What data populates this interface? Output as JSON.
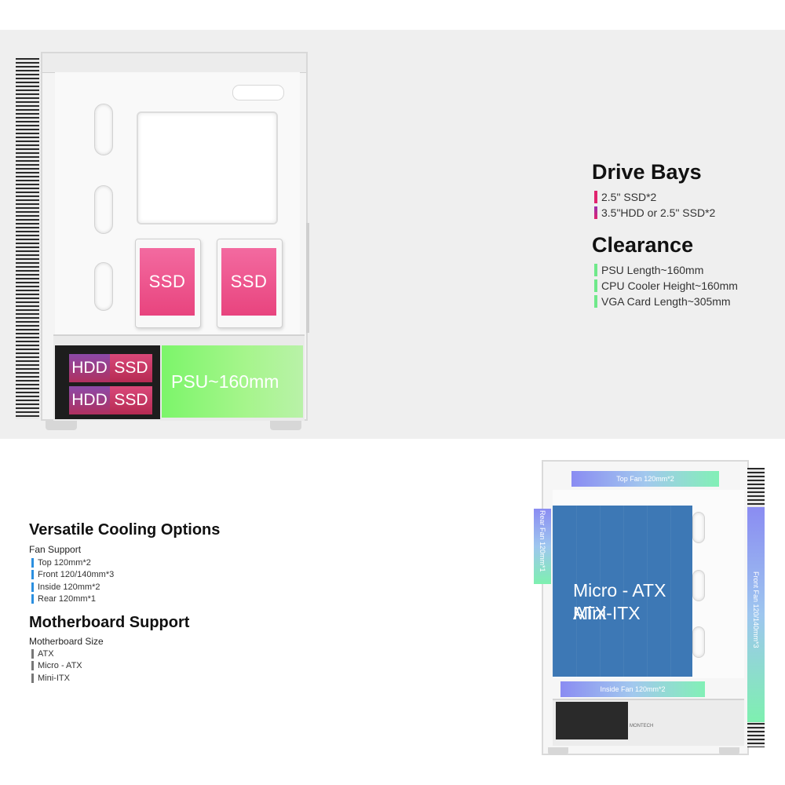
{
  "drive_bays": {
    "title": "Drive Bays",
    "items": [
      {
        "label": "2.5\" SSD*2",
        "color": "#e0246e"
      },
      {
        "label": "3.5\"HDD or 2.5\" SSD*2",
        "color": "#9a2fae"
      }
    ]
  },
  "clearance": {
    "title": "Clearance",
    "items": [
      {
        "label": "PSU Length~160mm",
        "color": "#6fe88a"
      },
      {
        "label": "CPU Cooler Height~160mm",
        "color": "#6fe88a"
      },
      {
        "label": "VGA Card Length~305mm",
        "color": "#6fe88a"
      }
    ]
  },
  "case_rear_view": {
    "ssd_label_1": "SSD",
    "ssd_label_2": "SSD",
    "hdd_label_1": "HDD",
    "ssd_label_3": "SSD",
    "hdd_label_2": "HDD",
    "ssd_label_4": "SSD",
    "psu_label": "PSU~160mm"
  },
  "cooling": {
    "title": "Versatile Cooling Options",
    "subtitle": "Fan Support",
    "items": [
      {
        "label": "Top 120mm*2",
        "color": "#2b8fe0"
      },
      {
        "label": "Front 120/140mm*3",
        "color": "#2b8fe0"
      },
      {
        "label": "Inside 120mm*2",
        "color": "#2b8fe0"
      },
      {
        "label": "Rear 120mm*1",
        "color": "#2b8fe0"
      }
    ]
  },
  "motherboard": {
    "title": "Motherboard Support",
    "subtitle": "Motherboard Size",
    "items": [
      {
        "label": "ATX",
        "color": "#777777"
      },
      {
        "label": "Micro - ATX",
        "color": "#777777"
      },
      {
        "label": "Mini-ITX",
        "color": "#777777"
      }
    ]
  },
  "case_front_view": {
    "top_fan": "Top Fan 120mm*2",
    "rear_fan": "Rear Fan 120mm*1",
    "front_fan": "Front Fan 120/140mm*3",
    "inside_fan": "Inside Fan 120mm*2",
    "mb_line1": "ATX",
    "mb_line2": "Micro - ATX",
    "mb_line3": "Mini-ITX",
    "brand": "MONTECH"
  }
}
